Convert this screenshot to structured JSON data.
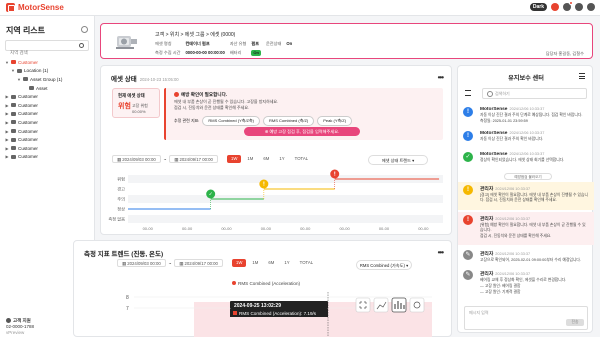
{
  "topbar": {
    "app_name": "MotorSense",
    "dark_label": "Dark",
    "colors": {
      "brand": "#e8432f",
      "accent": "#e8467c",
      "ok": "#2db34a",
      "warn": "#f5b800"
    }
  },
  "sidebar": {
    "title": "지역 리스트",
    "search_placeholder": "지역 검색",
    "items": [
      {
        "label": "Customer",
        "indent": 0,
        "chev": "▼",
        "active": true
      },
      {
        "label": "Location (1)",
        "indent": 1,
        "chev": "▼",
        "active": false
      },
      {
        "label": "Asset Group (1)",
        "indent": 2,
        "chev": "▼",
        "active": false
      },
      {
        "label": "Asset",
        "indent": 3,
        "chev": "",
        "active": false
      },
      {
        "label": "Customer",
        "indent": 0,
        "chev": "▶",
        "active": false
      },
      {
        "label": "Customer",
        "indent": 0,
        "chev": "▶",
        "active": false
      },
      {
        "label": "Customer",
        "indent": 0,
        "chev": "▶",
        "active": false
      },
      {
        "label": "Customer",
        "indent": 0,
        "chev": "▶",
        "active": false
      },
      {
        "label": "Customer",
        "indent": 0,
        "chev": "▶",
        "active": false
      },
      {
        "label": "Customer",
        "indent": 0,
        "chev": "▶",
        "active": false
      },
      {
        "label": "Customer",
        "indent": 0,
        "chev": "▶",
        "active": false
      },
      {
        "label": "Customer",
        "indent": 0,
        "chev": "▶",
        "active": false
      }
    ],
    "footer_label": "고객 지원",
    "footer_phone": "02-0000-1788",
    "footer_version": "vPreview"
  },
  "asset": {
    "path": "고객 > 위치 > 에셋 그룹 > 에셋 (0000)",
    "meta": [
      {
        "k": "에셋 명칭",
        "v": "컨테이너 펌프"
      },
      {
        "k": "자산 유형",
        "v": "펌프"
      },
      {
        "k": "운전상태",
        "v": "On"
      },
      {
        "k": "측정 수집 시간",
        "v": "0000-00-00 00:00:00"
      },
      {
        "k": "배터리",
        "v": "On"
      }
    ],
    "right_text": "담당자 홍길동, 김철수"
  },
  "asset_status": {
    "title": "에셋 상태",
    "timestamp": "2024-10-23 15:05:00",
    "box_title": "현재 에셋 상태",
    "box_value": "위험",
    "box_sub": "고장 위험 00.00%",
    "alert_title": "예방 확인이 필요합니다.",
    "alert_lines": [
      "에셋 내 부품 손상이 곧 진행될 수 있습니다. 고장을 방지하세요.",
      "점검 시, 진동치와 운전 상태를 확인해 주세요."
    ],
    "alert_tag_label": "추정 관련 지표:",
    "alert_tags": [
      "RMS Combined (Y축/Z축)",
      "RMS Combined (축/Z)",
      "Peak (Y축/Z)"
    ],
    "alert_cta": "예방 고장 점검 후, 점검을 입력해주세요.",
    "date_from": "2024/09/03 00:00",
    "date_to": "2024/09/17 00:00",
    "ranges": [
      "1W",
      "1M",
      "6M",
      "1Y",
      "TOTAL"
    ],
    "range_selected": "1W",
    "dropdown": "에셋 상태 트렌드"
  },
  "status_chart": {
    "type": "line",
    "categories": [
      "위험",
      "경고",
      "주의",
      "정상",
      "측정 없음"
    ],
    "x_labels": [
      "00-00",
      "00-00",
      "00-00",
      "00-00",
      "00-00",
      "00-00",
      "00-00",
      "00-00"
    ],
    "events": [
      {
        "state": "정상",
        "from": 0,
        "to": 2.1,
        "color": "#2d7ee8"
      },
      {
        "state": "주의",
        "from": 2.1,
        "to": 3.45,
        "color": "#2db34a"
      },
      {
        "state": "경고",
        "from": 3.45,
        "to": 5.25,
        "color": "#f5b800"
      },
      {
        "state": "위험",
        "from": 5.25,
        "to": 7.9,
        "color": "#e8432f"
      }
    ]
  },
  "trend": {
    "title": "측정 지표 트렌드 (진동, 온도)",
    "date_from": "2024/09/03 00:00",
    "date_to": "2024/09/17 00:00",
    "ranges": [
      "1W",
      "1M",
      "6M",
      "1Y",
      "TOTAL"
    ],
    "range_selected": "1W",
    "dropdown": "RMS Combined (가속도)",
    "legend": "RMS Combined (Acceleration)",
    "y_ticks": [
      "8",
      "7"
    ],
    "tooltip_time": "2024-09-25 13:02:29",
    "tooltip_series": "RMS Combined (Acceleration): 7.19/s"
  },
  "maintenance": {
    "title": "유지보수 센터",
    "search_placeholder": "검색하기",
    "more_label": "예방점검 불러오기",
    "input_placeholder": "메시지 입력",
    "send_label": "전송",
    "items": [
      {
        "author": "MotorSense",
        "time": "2024/12/06 10:33:37",
        "icon": "!",
        "color": "#2d7ee8",
        "hl": "",
        "body": [
          "자동 이상 진단 결과 주의 단계로 예상됩니다. 점검 확인 바랍니다.",
          "측정일: 2025-01-01 23:59:59"
        ]
      },
      {
        "author": "MotorSense",
        "time": "2024/12/06 10:33:37",
        "icon": "!",
        "color": "#2d7ee8",
        "hl": "",
        "body": [
          "자동 이상 진단 결과 주의 확인 바랍니다."
        ]
      },
      {
        "author": "MotorSense",
        "time": "2024/12/06 10:33:37",
        "icon": "✓",
        "color": "#2db34a",
        "hl": "",
        "body": [
          "정상이 확인되었습니다. 에셋 상태 회기를 선택합니다."
        ]
      },
      {
        "author": "관리자",
        "time": "2024/12/06 10:33:37",
        "icon": "!",
        "color": "#f5b800",
        "hl": "hl",
        "body": [
          "[경고] 에셋 확인이 필요합니다. 에셋 내 부품 손상이 진행될 수 있습니다. 점검 시, 진동치와 운전 상태를 확인해 주세요."
        ]
      },
      {
        "author": "관리자",
        "time": "2024/12/06 10:33:37",
        "icon": "!",
        "color": "#e8432f",
        "hl": "hl2",
        "body": [
          "[위험] 예방 확인이 필요합니다. 에셋 내 부품 손상이 곧 진행될 수 있습니다.",
          "점검 시, 진동치와 운전 상태를 확인해 주세요."
        ]
      },
      {
        "author": "관리자",
        "time": "2024/12/06 10:33:37",
        "icon": "✎",
        "color": "#888888",
        "hl": "",
        "body": [
          "고장으로 확인되어, 2025-02-01 09:00:00부터 수리 예정입니다."
        ]
      },
      {
        "author": "관리자",
        "time": "2024/12/06 10:33:37",
        "icon": "✎",
        "color": "#888888",
        "hl": "",
        "body": [
          "베어링 교체 후 정상화 확인, 에셋을 수리로 변경합니다.",
          "— 고장 원인: 베어링 결함",
          "— 고장 원인: 기계적 결함"
        ]
      }
    ]
  }
}
